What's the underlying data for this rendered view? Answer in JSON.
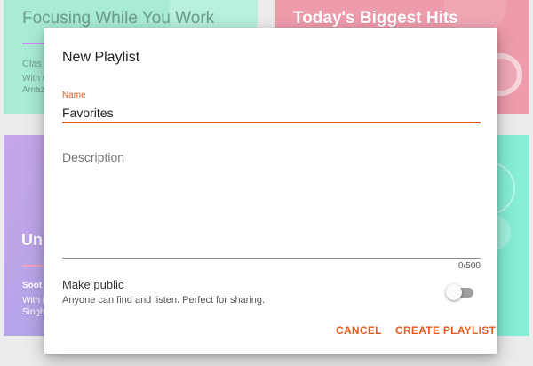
{
  "background_cards": {
    "top_left": {
      "title": "Focusing While You Work",
      "subtitle": "Clas",
      "line1": "With C",
      "line2": "Amaz"
    },
    "top_right": {
      "title": "Today's Biggest Hits"
    },
    "bottom_left": {
      "title": "Un",
      "subtitle": "Soot",
      "line1": "With i",
      "line2": "Singh"
    }
  },
  "dialog": {
    "title": "New Playlist",
    "name_field": {
      "label": "Name",
      "value": "Favorites"
    },
    "description_field": {
      "placeholder": "Description",
      "value": "",
      "counter": "0/500"
    },
    "make_public": {
      "title": "Make public",
      "description": "Anyone can find and listen. Perfect for sharing.",
      "enabled": false
    },
    "actions": {
      "cancel_label": "CANCEL",
      "create_label": "CREATE PLAYLIST"
    }
  },
  "colors": {
    "accent": "#e25d22",
    "card_top_left": "#a9ecd6",
    "card_top_right": "#ee9cab",
    "card_bottom_left": "#b0a4e8",
    "card_bottom_right": "#86efd6"
  }
}
